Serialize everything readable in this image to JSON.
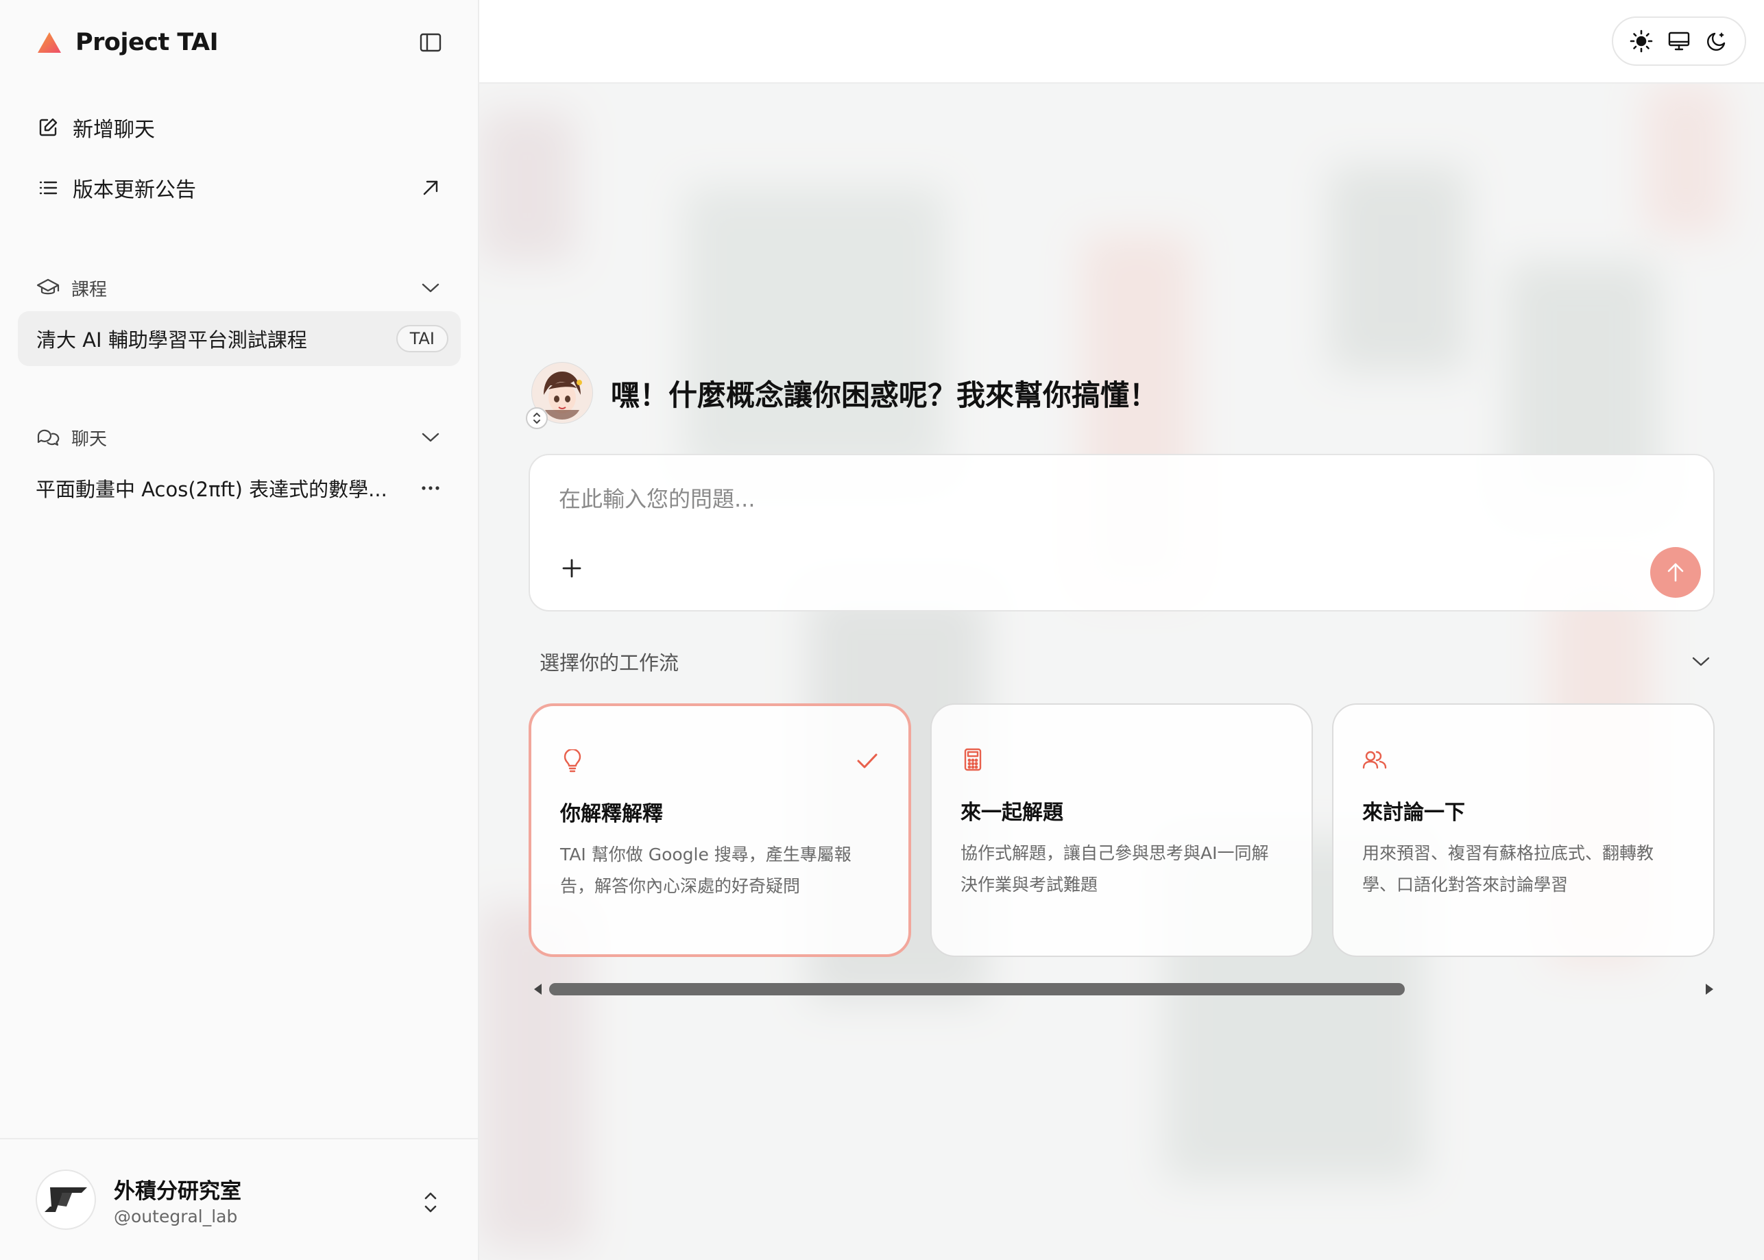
{
  "app": {
    "name": "Project TAI"
  },
  "sidebar": {
    "new_chat": "新增聊天",
    "changelog": "版本更新公告",
    "courses_header": "課程",
    "courses": [
      {
        "name": "清大 AI 輔助學習平台測試課程",
        "badge": "TAI"
      }
    ],
    "chats_header": "聊天",
    "chats": [
      {
        "title": "平面動畫中 Acos(2πft) 表達式的數學..."
      }
    ]
  },
  "profile": {
    "name": "外積分研究室",
    "handle": "@outegral_lab"
  },
  "main": {
    "greeting": "嘿！什麼概念讓你困惑呢？我來幫你搞懂！",
    "composer_placeholder": "在此輸入您的問題...",
    "workflow_header": "選擇你的工作流",
    "cards": [
      {
        "title": "你解釋解釋",
        "desc": "TAI 幫你做 Google 搜尋，產生專屬報告，解答你內心深處的好奇疑問",
        "selected": true,
        "icon": "lightbulb-icon"
      },
      {
        "title": "來一起解題",
        "desc": "協作式解題，讓自己參與思考與AI一同解決作業與考試難題",
        "selected": false,
        "icon": "calculator-icon"
      },
      {
        "title": "來討論一下",
        "desc": "用來預習、複習有蘇格拉底式、翻轉教學、口語化對答來討論學習",
        "selected": false,
        "icon": "users-icon"
      }
    ],
    "scroll": {
      "visible_fraction": 0.74
    }
  },
  "colors": {
    "accent": "#f19a8f",
    "accent_dark": "#e8604c",
    "selected_border": "#f2a79c"
  }
}
